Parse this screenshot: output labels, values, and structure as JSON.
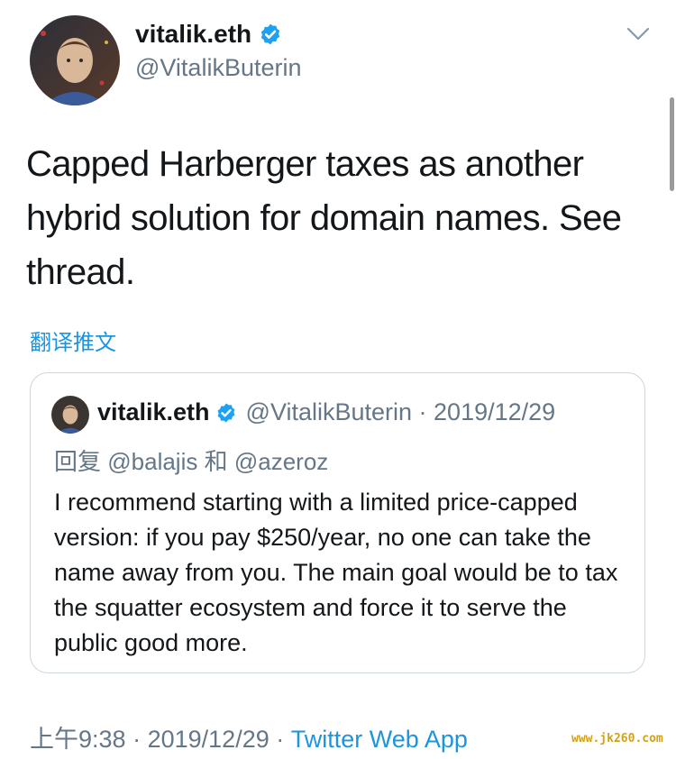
{
  "author": {
    "name": "vitalik.eth",
    "handle": "@VitalikButerin",
    "verified": true
  },
  "tweet": {
    "text": "Capped Harberger taxes as another hybrid solution for domain names. See thread.",
    "translate_label": "翻译推文"
  },
  "quoted_tweet": {
    "name": "vitalik.eth",
    "handle_date": "@VitalikButerin · 2019/12/29",
    "reply_prefix": "回复",
    "reply_user1": "@balajis",
    "reply_and": "和",
    "reply_user2": "@azeroz",
    "text": "I recommend starting with a limited price-capped version: if you pay $250/year, no one can take the name away from you. The main goal would be to tax the squatter ecosystem and force it to serve the public good more."
  },
  "footer": {
    "time": "上午9:38",
    "date": "2019/12/29",
    "separator": "·",
    "app": "Twitter Web App"
  },
  "watermark": "www.jk260.com",
  "colors": {
    "link": "#1b95e0",
    "verified": "#1da1f2",
    "secondary_text": "#657786",
    "border": "#ccd6dd"
  },
  "icons": [
    "verified-badge-icon",
    "chevron-down-icon"
  ]
}
